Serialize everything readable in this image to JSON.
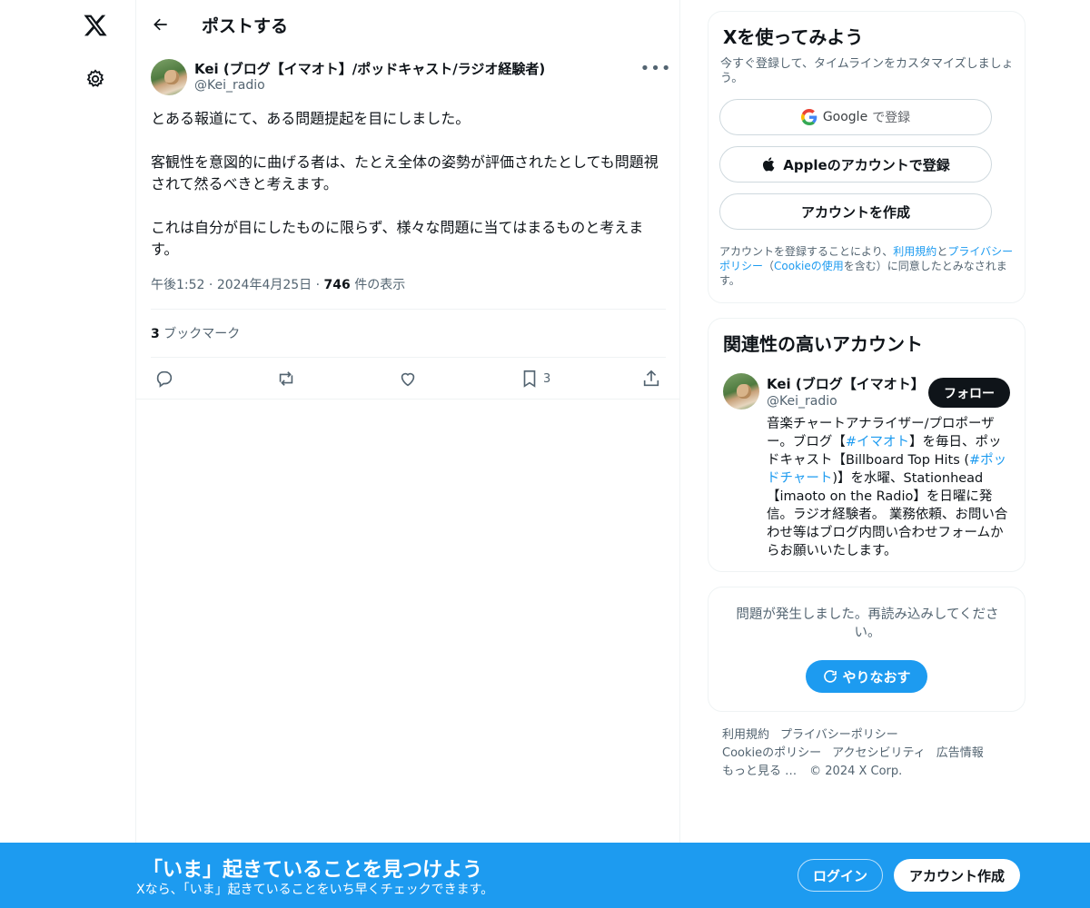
{
  "nav": {
    "logo_icon": "x-logo-icon",
    "settings_icon": "gear-icon"
  },
  "header": {
    "title": "ポストする",
    "back_icon": "back-arrow-icon"
  },
  "tweet": {
    "author_name": "Kei (ブログ【イマオト】/ポッドキャスト/ラジオ経験者)",
    "author_handle": "@Kei_radio",
    "paragraphs": [
      "とある報道にて、ある問題提起を目にしました。",
      "客観性を意図的に曲げる者は、たとえ全体の姿勢が評価されたとしても問題視されて然るべきと考えます。",
      "これは自分が目にしたものに限らず、様々な問題に当てはまるものと考えます。"
    ],
    "time": "午後1:52",
    "date": "2024年4月25日",
    "views_count": "746",
    "views_label": "件の表示",
    "bookmarks_count": "3",
    "bookmarks_label": "ブックマーク",
    "action_bookmark_count": "3"
  },
  "signup": {
    "title": "Xを使ってみよう",
    "subtitle": "今すぐ登録して、タイムラインをカスタマイズしましょう。",
    "google_brand": "Google",
    "google_suffix": "で登録",
    "apple_label": "Appleのアカウントで登録",
    "create_label": "アカウントを作成",
    "legal_prefix": "アカウントを登録することにより、",
    "legal_terms": "利用規約",
    "legal_and": "と",
    "legal_privacy": "プライバシーポリシー",
    "legal_paren_open": "（",
    "legal_cookie": "Cookieの使用",
    "legal_suffix": "を含む）に同意したとみなされます。"
  },
  "related": {
    "title": "関連性の高いアカウント",
    "name": "Kei (ブログ【イマオト】",
    "handle": "@Kei_radio",
    "follow_label": "フォロー",
    "bio_1": "音楽チャートアナライザー/プロポーザー。ブログ【",
    "bio_tag1": "#イマオト",
    "bio_2": "】を毎日、ポッドキャスト【Billboard Top Hits (",
    "bio_tag2": "#ポッドチャート",
    "bio_3": ")】を水曜、Stationhead【imaoto on the Radio】を日曜に発信。ラジオ経験者。 業務依頼、お問い合わせ等はブログ内問い合わせフォームからお願いいたします。"
  },
  "error": {
    "message": "問題が発生しました。再読み込みしてください。",
    "retry_label": "やりなおす"
  },
  "footer": {
    "terms": "利用規約",
    "privacy": "プライバシーポリシー",
    "cookie": "Cookieのポリシー",
    "accessibility": "アクセシビリティ",
    "ads": "広告情報",
    "more": "もっと見る …",
    "copyright": "© 2024 X Corp."
  },
  "banner": {
    "title": "「いま」起きていることを見つけよう",
    "subtitle": "Xなら、「いま」起きていることをいち早くチェックできます。",
    "login_label": "ログイン",
    "signup_label": "アカウント作成"
  },
  "colors": {
    "accent": "#1d9bf0",
    "text": "#0f1419",
    "muted": "#536471",
    "border": "#eff3f4"
  }
}
